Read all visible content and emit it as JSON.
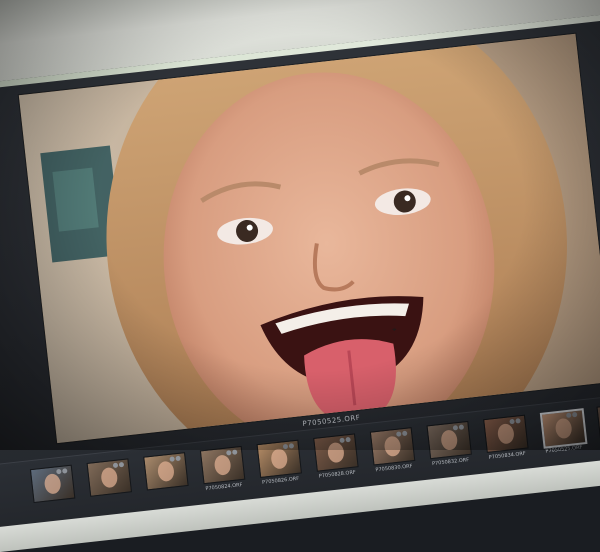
{
  "preview": {
    "filename": "P7050525.ORF"
  },
  "filmstrip": {
    "selected_index": 9,
    "thumbs": [
      {
        "label": "",
        "color": "#5d6b7c"
      },
      {
        "label": "",
        "color": "#7f6a58"
      },
      {
        "label": "",
        "color": "#a98a6c"
      },
      {
        "label": "P7050824.ORF",
        "color": "#8c7460"
      },
      {
        "label": "P7050826.ORF",
        "color": "#b58c66"
      },
      {
        "label": "P7050828.ORF",
        "color": "#7b5a48"
      },
      {
        "label": "P7050830.ORF",
        "color": "#9a7b68"
      },
      {
        "label": "P7050832.ORF",
        "color": "#7d6c60"
      },
      {
        "label": "P7050834.ORF",
        "color": "#8a5f4c"
      },
      {
        "label": "P7050525.ORF",
        "color": "#c99a7c"
      },
      {
        "label": "",
        "color": "#6f5a4e"
      }
    ]
  }
}
